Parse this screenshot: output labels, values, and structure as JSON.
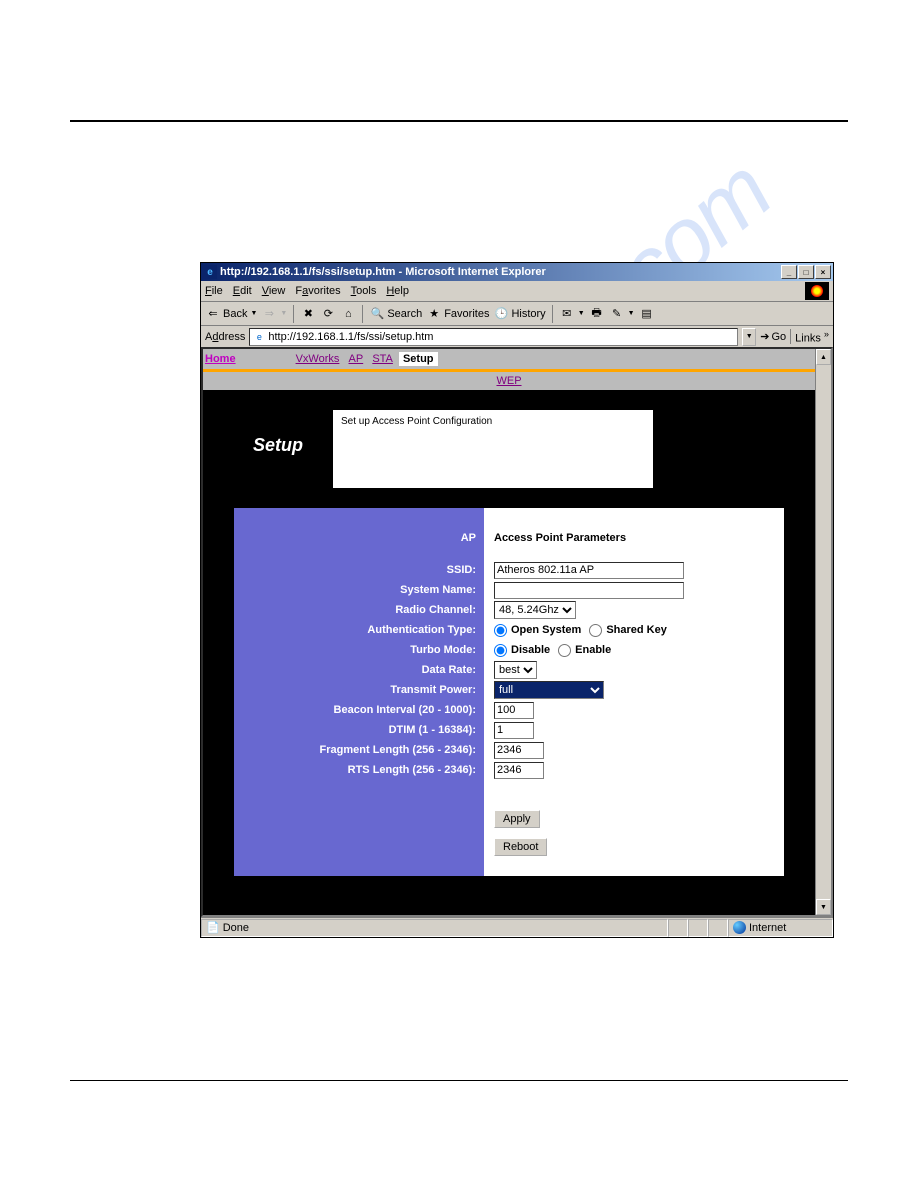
{
  "window": {
    "title": "http://192.168.1.1/fs/ssi/setup.htm - Microsoft Internet Explorer",
    "controls": {
      "min": "_",
      "max": "□",
      "close": "×"
    }
  },
  "menus": {
    "file": "File",
    "edit": "Edit",
    "view": "View",
    "favorites": "Favorites",
    "tools": "Tools",
    "help": "Help"
  },
  "toolbar": {
    "back": "Back",
    "search": "Search",
    "favorites": "Favorites",
    "history": "History"
  },
  "address": {
    "label": "Address",
    "value": "http://192.168.1.1/fs/ssi/setup.htm",
    "go": "Go",
    "links": "Links"
  },
  "nav": {
    "home": "Home",
    "vxworks": "VxWorks",
    "ap": "AP",
    "sta": "STA",
    "setup": "Setup",
    "wep": "WEP"
  },
  "header": {
    "title": "Setup",
    "description": "Set up Access Point Configuration"
  },
  "form": {
    "ap_label": "AP",
    "ap_heading": "Access Point Parameters",
    "ssid_label": "SSID:",
    "ssid_value": "Atheros 802.11a AP",
    "system_name_label": "System Name:",
    "system_name_value": "",
    "radio_channel_label": "Radio Channel:",
    "radio_channel_value": "48, 5.24Ghz",
    "auth_type_label": "Authentication Type:",
    "auth_open": "Open System",
    "auth_shared": "Shared Key",
    "turbo_label": "Turbo Mode:",
    "turbo_disable": "Disable",
    "turbo_enable": "Enable",
    "data_rate_label": "Data Rate:",
    "data_rate_value": "best",
    "tx_power_label": "Transmit Power:",
    "tx_power_value": "full",
    "beacon_label": "Beacon Interval (20 - 1000):",
    "beacon_value": "100",
    "dtim_label": "DTIM (1 - 16384):",
    "dtim_value": "1",
    "fragment_label": "Fragment Length (256 - 2346):",
    "fragment_value": "2346",
    "rts_label": "RTS Length (256 - 2346):",
    "rts_value": "2346",
    "apply": "Apply",
    "reboot": "Reboot"
  },
  "status": {
    "left": "Done",
    "right": "Internet"
  },
  "watermark": "manualslib.com"
}
